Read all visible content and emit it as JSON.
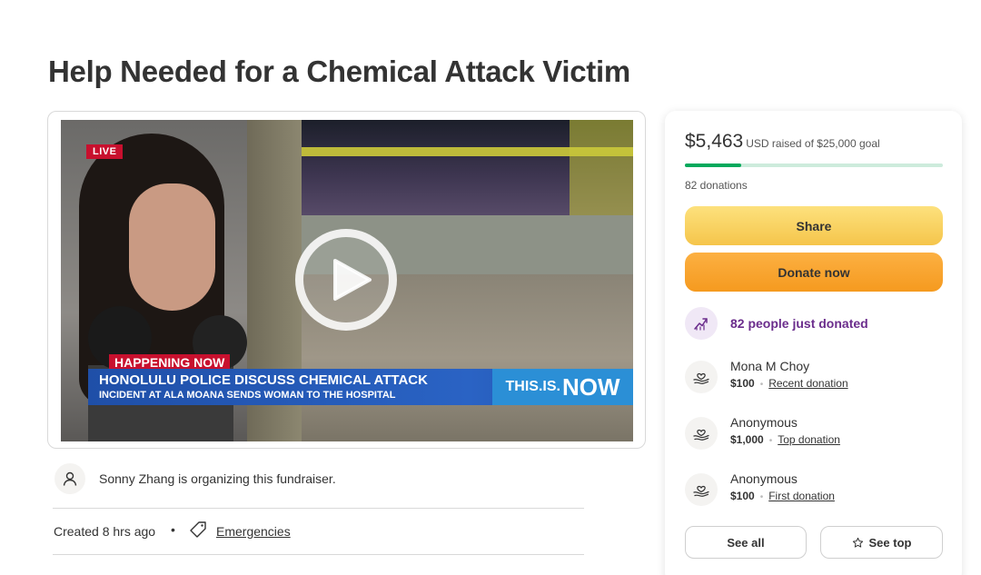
{
  "page": {
    "title": "Help Needed for a Chemical Attack Victim"
  },
  "video": {
    "live_label": "LIVE",
    "happening_label": "HAPPENING NOW",
    "headline": "HONOLULU POLICE DISCUSS CHEMICAL ATTACK",
    "subheadline": "INCIDENT AT ALA MOANA SENDS WOMAN TO THE HOSPITAL",
    "brand_prefix": "THIS.IS.",
    "brand_word": "NOW"
  },
  "organizer": {
    "text": "Sonny Zhang is organizing this fundraiser."
  },
  "meta": {
    "created": "Created 8 hrs ago",
    "separator": "•",
    "category": "Emergencies"
  },
  "donation_panel": {
    "raised_amount": "$5,463",
    "raised_rest": "USD raised of $25,000 goal",
    "progress_fraction": 0.2185,
    "progress_color": "#02a95c",
    "donation_count": "82 donations",
    "share_label": "Share",
    "donate_label": "Donate now",
    "recent_activity": "82 people just donated",
    "donors": [
      {
        "name": "Mona M Choy",
        "amount": "$100",
        "tag": "Recent donation"
      },
      {
        "name": "Anonymous",
        "amount": "$1,000",
        "tag": "Top donation"
      },
      {
        "name": "Anonymous",
        "amount": "$100",
        "tag": "First donation"
      }
    ],
    "see_all_label": "See all",
    "see_top_label": "See top"
  }
}
